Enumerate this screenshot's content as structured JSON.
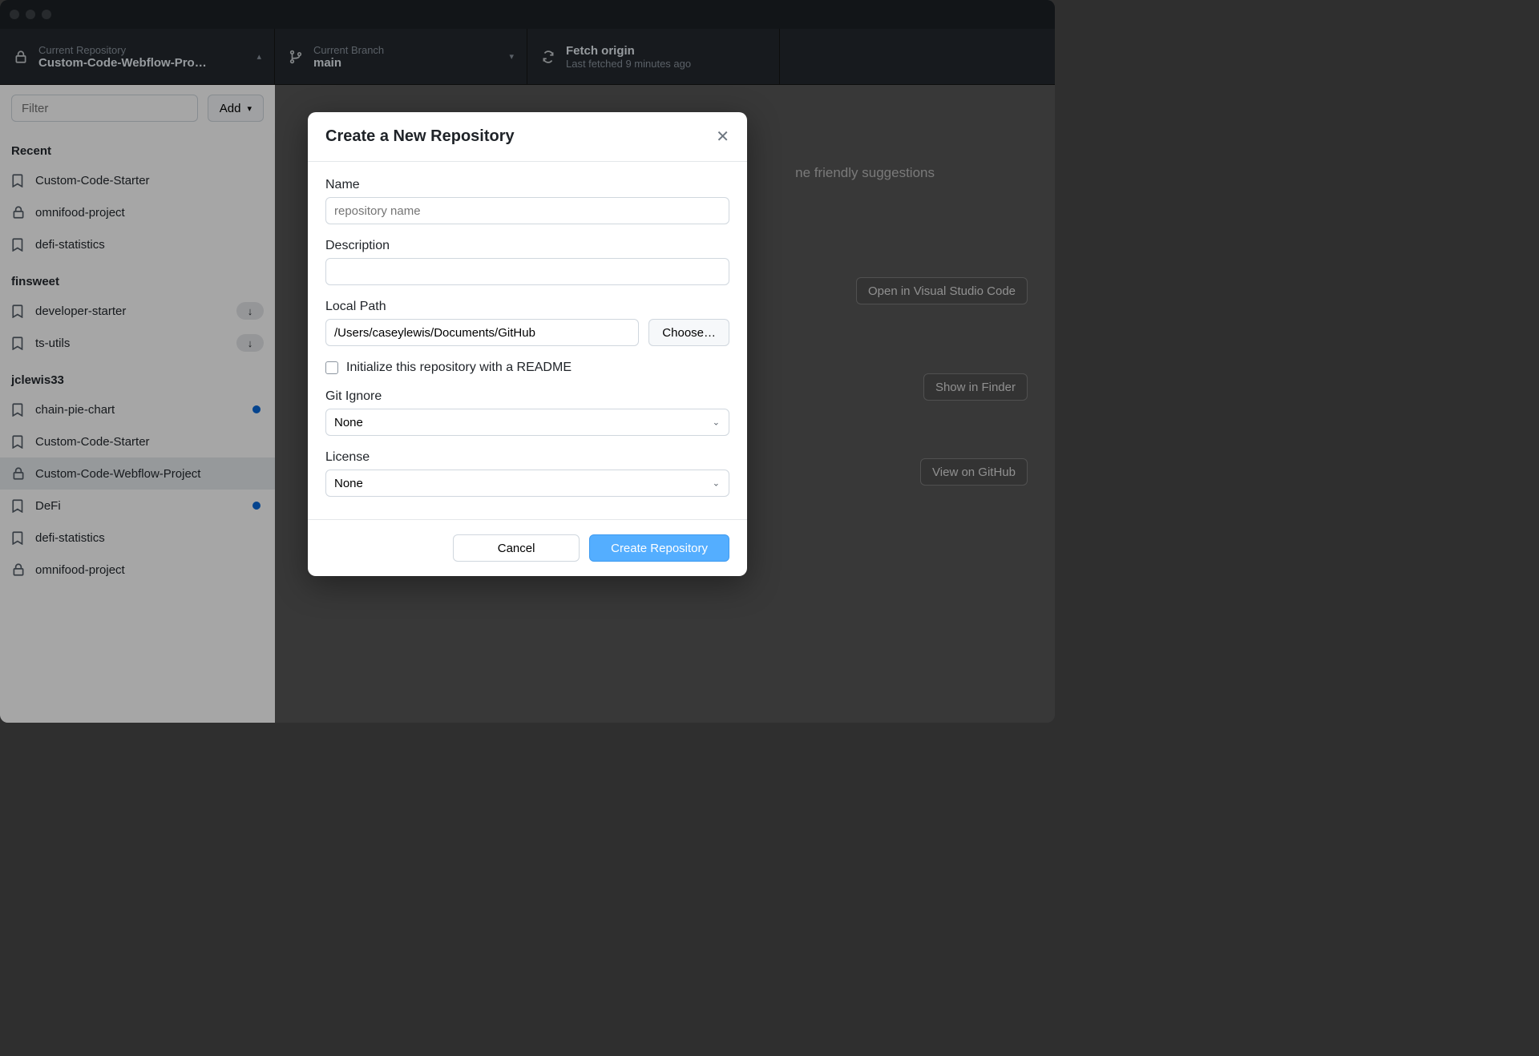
{
  "toolbar": {
    "repo": {
      "label": "Current Repository",
      "value": "Custom-Code-Webflow-Pro…"
    },
    "branch": {
      "label": "Current Branch",
      "value": "main"
    },
    "fetch": {
      "label": "Fetch origin",
      "value": "Last fetched 9 minutes ago"
    }
  },
  "sidebar": {
    "filter_placeholder": "Filter",
    "add_label": "Add",
    "groups": [
      {
        "title": "Recent",
        "items": [
          {
            "icon": "bookmark",
            "name": "Custom-Code-Starter"
          },
          {
            "icon": "lock",
            "name": "omnifood-project"
          },
          {
            "icon": "bookmark",
            "name": "defi-statistics"
          }
        ]
      },
      {
        "title": "finsweet",
        "items": [
          {
            "icon": "bookmark",
            "name": "developer-starter",
            "pill": "↓"
          },
          {
            "icon": "bookmark",
            "name": "ts-utils",
            "pill": "↓"
          }
        ]
      },
      {
        "title": "jclewis33",
        "items": [
          {
            "icon": "bookmark",
            "name": "chain-pie-chart",
            "dot": true
          },
          {
            "icon": "bookmark",
            "name": "Custom-Code-Starter"
          },
          {
            "icon": "lock",
            "name": "Custom-Code-Webflow-Project",
            "selected": true
          },
          {
            "icon": "bookmark",
            "name": "DeFi",
            "dot": true
          },
          {
            "icon": "bookmark",
            "name": "defi-statistics"
          },
          {
            "icon": "lock",
            "name": "omnifood-project"
          }
        ]
      }
    ]
  },
  "content": {
    "hint": "ne friendly suggestions",
    "buttons": {
      "vscode": "Open in Visual Studio Code",
      "finder": "Show in Finder",
      "github": "View on GitHub"
    }
  },
  "modal": {
    "title": "Create a New Repository",
    "name_label": "Name",
    "name_placeholder": "repository name",
    "description_label": "Description",
    "local_path_label": "Local Path",
    "local_path_value": "/Users/caseylewis/Documents/GitHub",
    "choose_label": "Choose…",
    "readme_label": "Initialize this repository with a README",
    "gitignore_label": "Git Ignore",
    "gitignore_value": "None",
    "license_label": "License",
    "license_value": "None",
    "cancel_label": "Cancel",
    "create_label": "Create Repository"
  }
}
